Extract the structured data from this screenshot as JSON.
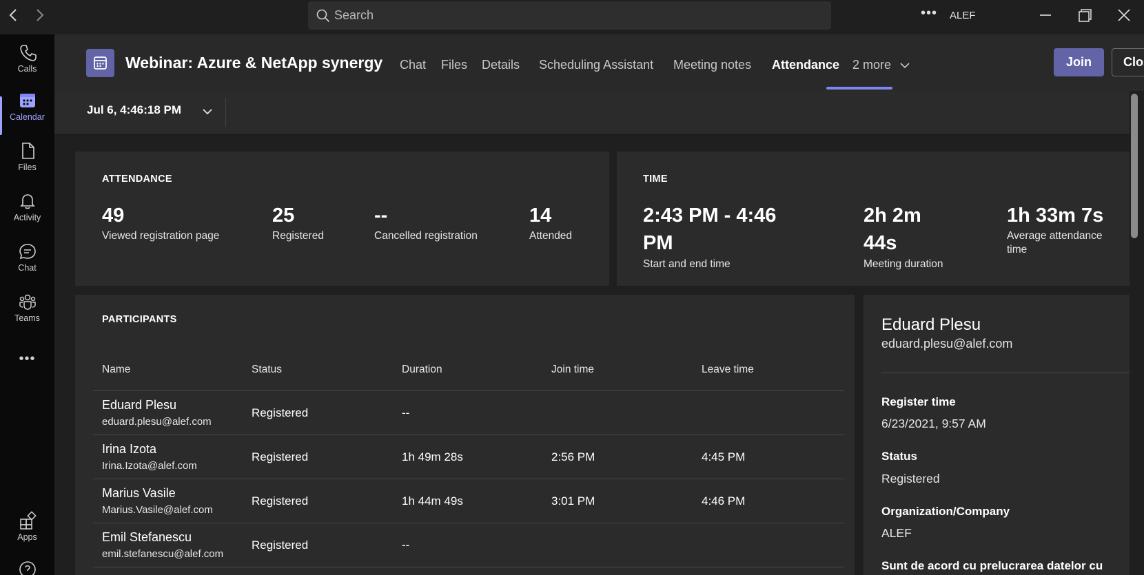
{
  "search": {
    "placeholder": "Search"
  },
  "titlebar": {
    "user": "ALEF"
  },
  "rail": {
    "items": [
      {
        "label": "Calls"
      },
      {
        "label": "Calendar"
      },
      {
        "label": "Files"
      },
      {
        "label": "Activity"
      },
      {
        "label": "Chat"
      },
      {
        "label": "Teams"
      },
      {
        "label": "Apps"
      }
    ]
  },
  "header": {
    "title": "Webinar: Azure & NetApp synergy",
    "tabs": [
      {
        "label": "Chat"
      },
      {
        "label": "Files"
      },
      {
        "label": "Details"
      },
      {
        "label": "Scheduling Assistant"
      },
      {
        "label": "Meeting notes"
      },
      {
        "label": "Attendance"
      },
      {
        "label": "2 more"
      }
    ],
    "join_label": "Join",
    "close_label": "Close"
  },
  "datebar": {
    "selected": "Jul 6, 4:46:18 PM"
  },
  "attendance": {
    "title": "ATTENDANCE",
    "stats": [
      {
        "value": "49",
        "label": "Viewed registration page"
      },
      {
        "value": "25",
        "label": "Registered"
      },
      {
        "value": "--",
        "label": "Cancelled registration"
      },
      {
        "value": "14",
        "label": "Attended"
      }
    ]
  },
  "time": {
    "title": "TIME",
    "stats": [
      {
        "value_line1": "2:43 PM - 4:46",
        "value_line2": "PM",
        "label": "Start and end time"
      },
      {
        "value_line1": "2h 2m",
        "value_line2": "44s",
        "label": "Meeting duration"
      },
      {
        "value_line1": "1h 33m 7s",
        "label_line1": "Average attendance",
        "label_line2": "time"
      }
    ]
  },
  "participants": {
    "title": "PARTICIPANTS",
    "columns": [
      "Name",
      "Status",
      "Duration",
      "Join time",
      "Leave time"
    ],
    "rows": [
      {
        "name": "Eduard Plesu",
        "email": "eduard.plesu@alef.com",
        "status": "Registered",
        "duration": "--",
        "join": "",
        "leave": ""
      },
      {
        "name": "Irina Izota",
        "email": "Irina.Izota@alef.com",
        "status": "Registered",
        "duration": "1h 49m 28s",
        "join": "2:56 PM",
        "leave": "4:45 PM"
      },
      {
        "name": "Marius Vasile",
        "email": "Marius.Vasile@alef.com",
        "status": "Registered",
        "duration": "1h 44m 49s",
        "join": "3:01 PM",
        "leave": "4:46 PM"
      },
      {
        "name": "Emil Stefanescu",
        "email": "emil.stefanescu@alef.com",
        "status": "Registered",
        "duration": "--",
        "join": "",
        "leave": ""
      }
    ]
  },
  "detail": {
    "name": "Eduard Plesu",
    "email": "eduard.plesu@alef.com",
    "fields": [
      {
        "label": "Register time",
        "value": "6/23/2021, 9:57 AM"
      },
      {
        "label": "Status",
        "value": "Registered"
      },
      {
        "label": "Organization/Company",
        "value": "ALEF"
      },
      {
        "label": "Sunt de acord cu prelucrarea datelor cu",
        "value": ""
      }
    ]
  },
  "colors": {
    "accent": "#6264a7",
    "accent_light": "#7f85f5",
    "rail_active": "#9ea2ff"
  }
}
